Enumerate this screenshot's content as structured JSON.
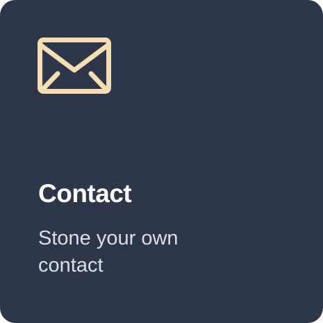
{
  "card": {
    "icon": "envelope-icon",
    "icon_color": "#f5deb3",
    "background": "#2e374a",
    "title": "Contact",
    "description": "Stone your own contact"
  }
}
